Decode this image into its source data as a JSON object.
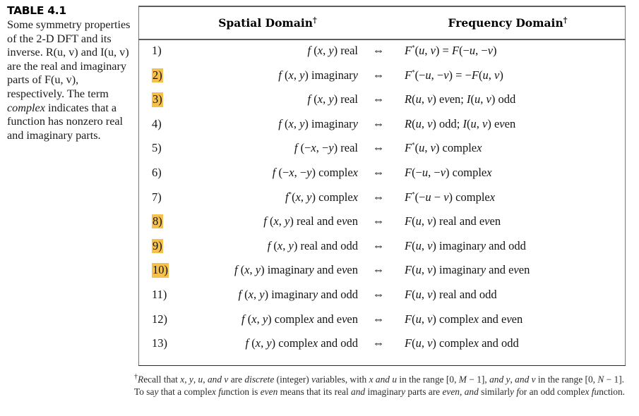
{
  "caption": {
    "label": "TABLE 4.1",
    "description_parts": [
      {
        "text": "Some symmetry properties of the 2-D DFT and its inverse. R(u, v) and I(u, v) are the real and imaginary parts of F(u, v), respectively. The term ",
        "style": "normal"
      },
      {
        "text": "complex",
        "style": "italic"
      },
      {
        "text": " indicates that a function has nonzero real and imaginary parts.",
        "style": "normal"
      }
    ],
    "description_plain": "Some symmetry properties of the 2-D DFT and its inverse. R(u, v) and I(u, v) are the real and imaginary parts of F(u, v), respectively. The term complex indicates that a function has nonzero real and imaginary parts."
  },
  "table": {
    "headers": {
      "number": "",
      "spatial": "Spatial Domain",
      "spatial_marker": "†",
      "arrow": "",
      "frequency": "Frequency Domain",
      "frequency_marker": "†"
    },
    "arrow_symbol": "⇔",
    "highlight_color": "#f6c04c",
    "rows": [
      {
        "num": "1)",
        "highlighted": false,
        "spatial": "f (x, y) real",
        "frequency": "F*(u, v) = F(−u, −v)"
      },
      {
        "num": "2)",
        "highlighted": true,
        "spatial": "f (x, y) imaginary",
        "frequency": "F*(−u, −v) = −F(u, v)"
      },
      {
        "num": "3)",
        "highlighted": true,
        "spatial": "f (x, y) real",
        "frequency": "R(u, v) even; I(u, v) odd"
      },
      {
        "num": "4)",
        "highlighted": false,
        "spatial": "f (x, y) imaginary",
        "frequency": "R(u, v) odd; I(u, v) even"
      },
      {
        "num": "5)",
        "highlighted": false,
        "spatial": "f (−x, −y) real",
        "frequency": "F*(u, v) complex"
      },
      {
        "num": "6)",
        "highlighted": false,
        "spatial": "f (−x, −y) complex",
        "frequency": "F(−u, −v) complex"
      },
      {
        "num": "7)",
        "highlighted": false,
        "spatial": "f*(x, y) complex",
        "frequency": "F*(−u − v) complex"
      },
      {
        "num": "8)",
        "highlighted": true,
        "spatial": "f (x, y) real and even",
        "frequency": "F(u, v) real and even"
      },
      {
        "num": "9)",
        "highlighted": true,
        "spatial": "f (x, y) real and odd",
        "frequency": "F(u, v) imaginary and odd"
      },
      {
        "num": "10)",
        "highlighted": true,
        "spatial": "f (x, y) imaginary and even",
        "frequency": "F(u, v) imaginary and even"
      },
      {
        "num": "11)",
        "highlighted": false,
        "spatial": "f (x, y) imaginary and odd",
        "frequency": "F(u, v) real and odd"
      },
      {
        "num": "12)",
        "highlighted": false,
        "spatial": "f (x, y) complex and even",
        "frequency": "F(u, v) complex and even"
      },
      {
        "num": "13)",
        "highlighted": false,
        "spatial": "f (x, y) complex and odd",
        "frequency": "F(u, v) complex and odd"
      }
    ]
  },
  "footnote": {
    "marker": "†",
    "text": "Recall that x, y, u, and v are discrete (integer) variables, with x and u in the range [0, M − 1], and y, and v in the range [0, N − 1]. To say that a complex function is even means that its real and imaginary parts are even, and similarly for an odd complex function.",
    "italic_words": [
      "discrete",
      "even",
      "and"
    ]
  }
}
